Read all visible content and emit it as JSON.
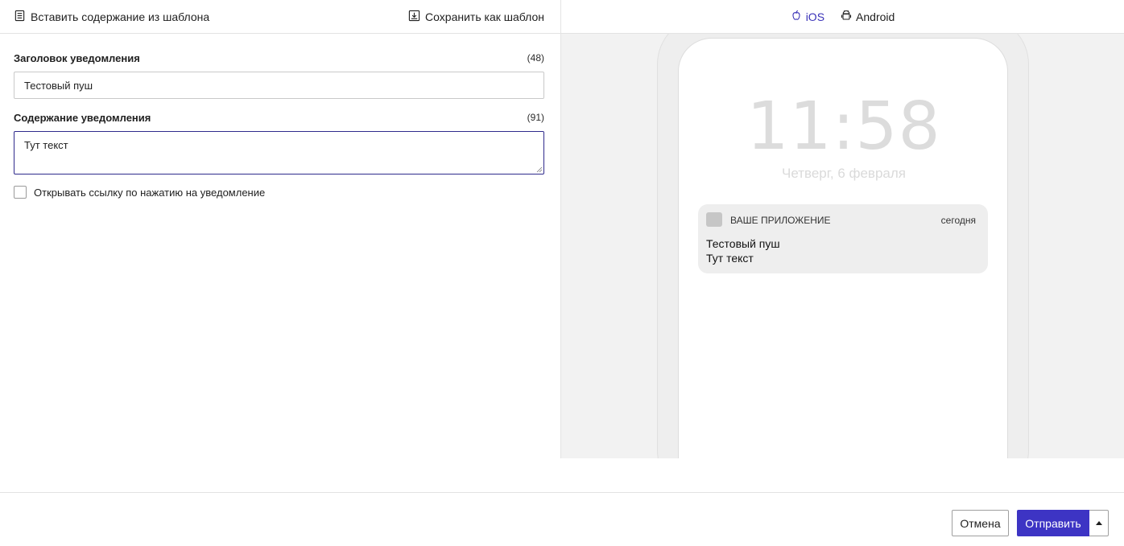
{
  "toolbar": {
    "insert_label": "Вставить содержание из шаблона",
    "save_label": "Сохранить как шаблон"
  },
  "title_field": {
    "label": "Заголовок уведомления",
    "counter": "(48)",
    "value": "Тестовый пуш"
  },
  "body_field": {
    "label": "Содержание уведомления",
    "counter": "(91)",
    "value": "Тут текст"
  },
  "link_checkbox": {
    "label": "Открывать ссылку по нажатию на уведомление",
    "checked": false
  },
  "preview": {
    "tabs": [
      {
        "label": "iOS",
        "icon": "apple-icon",
        "active": true
      },
      {
        "label": "Android",
        "icon": "android-icon",
        "active": false
      }
    ],
    "clock": "11:58",
    "date": "Четверг, 6 февраля",
    "notification": {
      "app_name": "ВАШЕ ПРИЛОЖЕНИЕ",
      "time": "сегодня",
      "title": "Тестовый пуш",
      "body": "Тут текст"
    }
  },
  "footer": {
    "cancel_label": "Отмена",
    "send_label": "Отправить"
  },
  "colors": {
    "accent": "#3d34c4",
    "active_tab": "#3a32b8",
    "focus_border": "#2f2a8c"
  }
}
